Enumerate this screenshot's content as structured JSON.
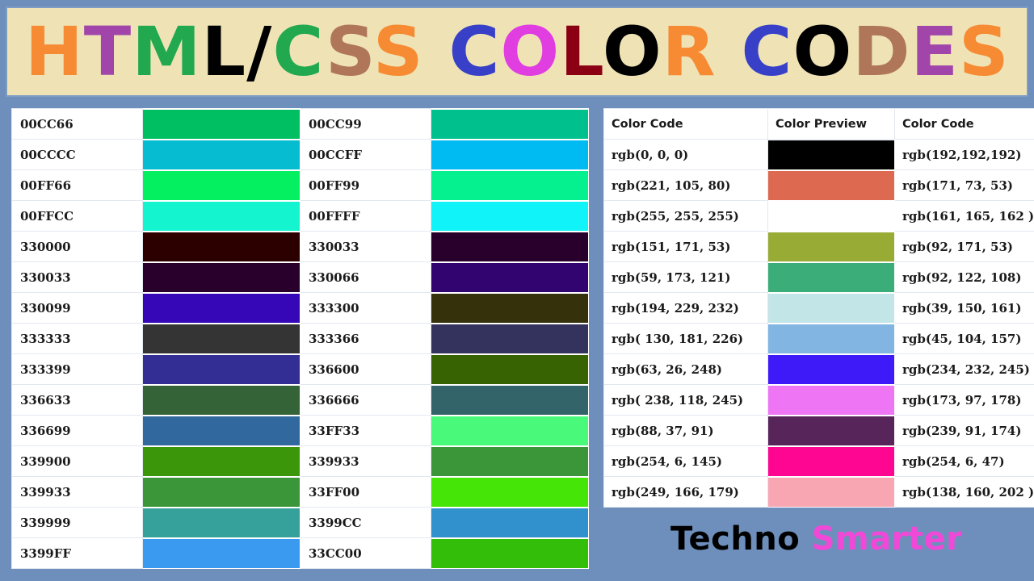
{
  "background_color": "#6e8fbc",
  "banner": {
    "background_color": "#efe3b6",
    "border_color": "#7e9cc4",
    "title_plain": "HTML/CSS COLOR CODES",
    "title_letters": [
      {
        "ch": "H",
        "color": "#f68b33"
      },
      {
        "ch": "T",
        "color": "#a145ab"
      },
      {
        "ch": "M",
        "color": "#22a94f"
      },
      {
        "ch": "L",
        "color": "#000000"
      },
      {
        "ch": "/",
        "color": "#000000"
      },
      {
        "ch": "C",
        "color": "#22a94f"
      },
      {
        "ch": "S",
        "color": "#b0765a"
      },
      {
        "ch": "S",
        "color": "#f68b33"
      },
      {
        "ch": " ",
        "color": "#000000"
      },
      {
        "ch": "C",
        "color": "#3840c8"
      },
      {
        "ch": "O",
        "color": "#e13ee1"
      },
      {
        "ch": "L",
        "color": "#8b0013"
      },
      {
        "ch": "O",
        "color": "#000000"
      },
      {
        "ch": "R",
        "color": "#f68b33"
      },
      {
        "ch": " ",
        "color": "#000000"
      },
      {
        "ch": "C",
        "color": "#3840c8"
      },
      {
        "ch": "O",
        "color": "#000000"
      },
      {
        "ch": "D",
        "color": "#b0765a"
      },
      {
        "ch": "E",
        "color": "#a145ab"
      },
      {
        "ch": "S",
        "color": "#f68b33"
      }
    ]
  },
  "hex_table": {
    "rows": [
      {
        "code_left": "00CC66",
        "swatch_left": "#00bf63",
        "code_right": "00CC99",
        "swatch_right": "#00c08d"
      },
      {
        "code_left": "00CCCC",
        "swatch_left": "#05bcd0",
        "code_right": "00CCFF",
        "swatch_right": "#00bbf2"
      },
      {
        "code_left": "00FF66",
        "swatch_left": "#05f060",
        "code_right": "00FF99",
        "swatch_right": "#05f08e"
      },
      {
        "code_left": "00FFCC",
        "swatch_left": "#14f5cf",
        "code_right": "00FFFF",
        "swatch_right": "#10f3f8"
      },
      {
        "code_left": "330000",
        "swatch_left": "#2d0000",
        "code_right": "330033",
        "swatch_right": "#29002c"
      },
      {
        "code_left": "330033",
        "swatch_left": "#29002c",
        "code_right": "330066",
        "swatch_right": "#32046f"
      },
      {
        "code_left": "330099",
        "swatch_left": "#3507b7",
        "code_right": "333300",
        "swatch_right": "#35310a"
      },
      {
        "code_left": "333333",
        "swatch_left": "#343434",
        "code_right": "333366",
        "swatch_right": "#33335e"
      },
      {
        "code_left": "333399",
        "swatch_left": "#322e93",
        "code_right": "336600",
        "swatch_right": "#376302"
      },
      {
        "code_left": "336633",
        "swatch_left": "#336336",
        "code_right": "336666",
        "swatch_right": "#33646a"
      },
      {
        "code_left": "336699",
        "swatch_left": "#31699e",
        "code_right": "33FF33",
        "swatch_right": "#48f97a"
      },
      {
        "code_left": "339900",
        "swatch_left": "#3b9609",
        "code_right": "339933",
        "swatch_right": "#3b9639"
      },
      {
        "code_left": "339933",
        "swatch_left": "#3b9639",
        "code_right": "33FF00",
        "swatch_right": "#45e508"
      },
      {
        "code_left": "339999",
        "swatch_left": "#36a09b",
        "code_right": "3399CC",
        "swatch_right": "#3191cc"
      },
      {
        "code_left": "3399FF",
        "swatch_left": "#3a9af0",
        "code_right": "33CC00",
        "swatch_right": "#33be09"
      }
    ]
  },
  "rgb_table": {
    "headers": [
      "Color Code",
      "Color Preview",
      "Color Code"
    ],
    "rows": [
      {
        "code_left": "rgb(0, 0, 0)",
        "swatch": "#000000",
        "code_right": "rgb(192,192,192)"
      },
      {
        "code_left": "rgb(221, 105, 80)",
        "swatch": "#dd6950",
        "code_right": "rgb(171, 73, 53)"
      },
      {
        "code_left": "rgb(255, 255, 255)",
        "swatch": "#ffffff",
        "code_right": "rgb(161, 165, 162 )"
      },
      {
        "code_left": "rgb(151, 171, 53)",
        "swatch": "#97ab35",
        "code_right": "rgb(92, 171, 53)"
      },
      {
        "code_left": "rgb(59, 173, 121)",
        "swatch": "#3bad79",
        "code_right": "rgb(92, 122, 108)"
      },
      {
        "code_left": "rgb(194, 229, 232)",
        "swatch": "#c2e5e8",
        "code_right": "rgb(39, 150, 161)"
      },
      {
        "code_left": "rgb( 130, 181, 226)",
        "swatch": "#82b5e2",
        "code_right": "rgb(45, 104, 157)"
      },
      {
        "code_left": "rgb(63, 26, 248)",
        "swatch": "#3f1af8",
        "code_right": "rgb(234, 232, 245)"
      },
      {
        "code_left": "rgb( 238, 118, 245)",
        "swatch": "#ee76f5",
        "code_right": "rgb(173, 97, 178)"
      },
      {
        "code_left": "rgb(88, 37, 91)",
        "swatch": "#58255b",
        "code_right": "rgb(239, 91, 174)"
      },
      {
        "code_left": "rgb(254, 6, 145)",
        "swatch": "#fe0691",
        "code_right": "rgb(254, 6, 47)"
      },
      {
        "code_left": "rgb(249, 166, 179)",
        "swatch": "#f9a6b3",
        "code_right": "rgb(138, 160, 202 )"
      }
    ]
  },
  "watermark": {
    "part1": "Techno ",
    "part1_color": "#000000",
    "part2": "Smarter",
    "part2_color": "#f248d8"
  }
}
